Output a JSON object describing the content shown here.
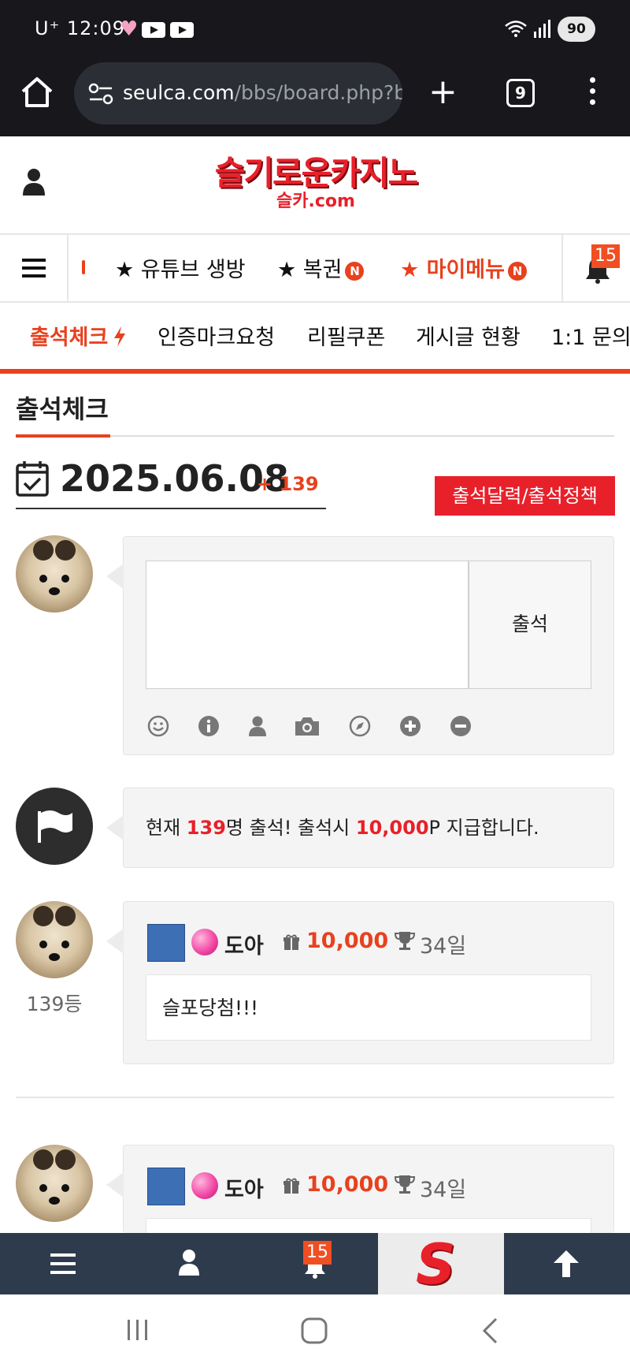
{
  "status_bar": {
    "carrier": "U⁺ 12:09",
    "battery": "90"
  },
  "browser": {
    "url_host": "seulca.com",
    "url_path": "/bbs/board.php?bo",
    "tab_count": "9"
  },
  "site": {
    "logo_main": "슬기로운카지노",
    "logo_sub": "슬카.com"
  },
  "top_nav": {
    "items": [
      {
        "label": "★ 유튜브 생방",
        "badge": ""
      },
      {
        "label": "★ 복권",
        "badge": "N"
      },
      {
        "label": "★ 마이메뉴",
        "badge": "N"
      }
    ],
    "notification_count": "15"
  },
  "sub_nav": {
    "items": [
      "출석체크",
      "인증마크요청",
      "리필쿠폰",
      "게시글 현황",
      "1:1 문의"
    ]
  },
  "page": {
    "title": "출석체크",
    "date": "2025.06.08",
    "count": "+ 139",
    "calendar_button": "출석달력/출석정책"
  },
  "attend_form": {
    "submit_label": "출석",
    "tools": [
      "smile-icon",
      "info-icon",
      "user-icon",
      "camera-icon",
      "compass-icon",
      "plus-icon",
      "minus-icon"
    ]
  },
  "notice": {
    "prefix": "현재 ",
    "count": "139",
    "mid": "명 출석! 출석시 ",
    "points": "10,000",
    "suffix": "P 지급합니다."
  },
  "posts": [
    {
      "nick": "도아",
      "points": "10,000",
      "days": "34일",
      "message": "슬포당첨!!!",
      "rank": "139등"
    },
    {
      "nick": "도아",
      "points": "10,000",
      "days": "34일"
    }
  ],
  "bottom_bar": {
    "notification_count": "15",
    "logo": "S"
  },
  "colors": {
    "accent": "#e8411e",
    "brand_red": "#e8202a",
    "bottom_bar": "#2e3b4c"
  }
}
